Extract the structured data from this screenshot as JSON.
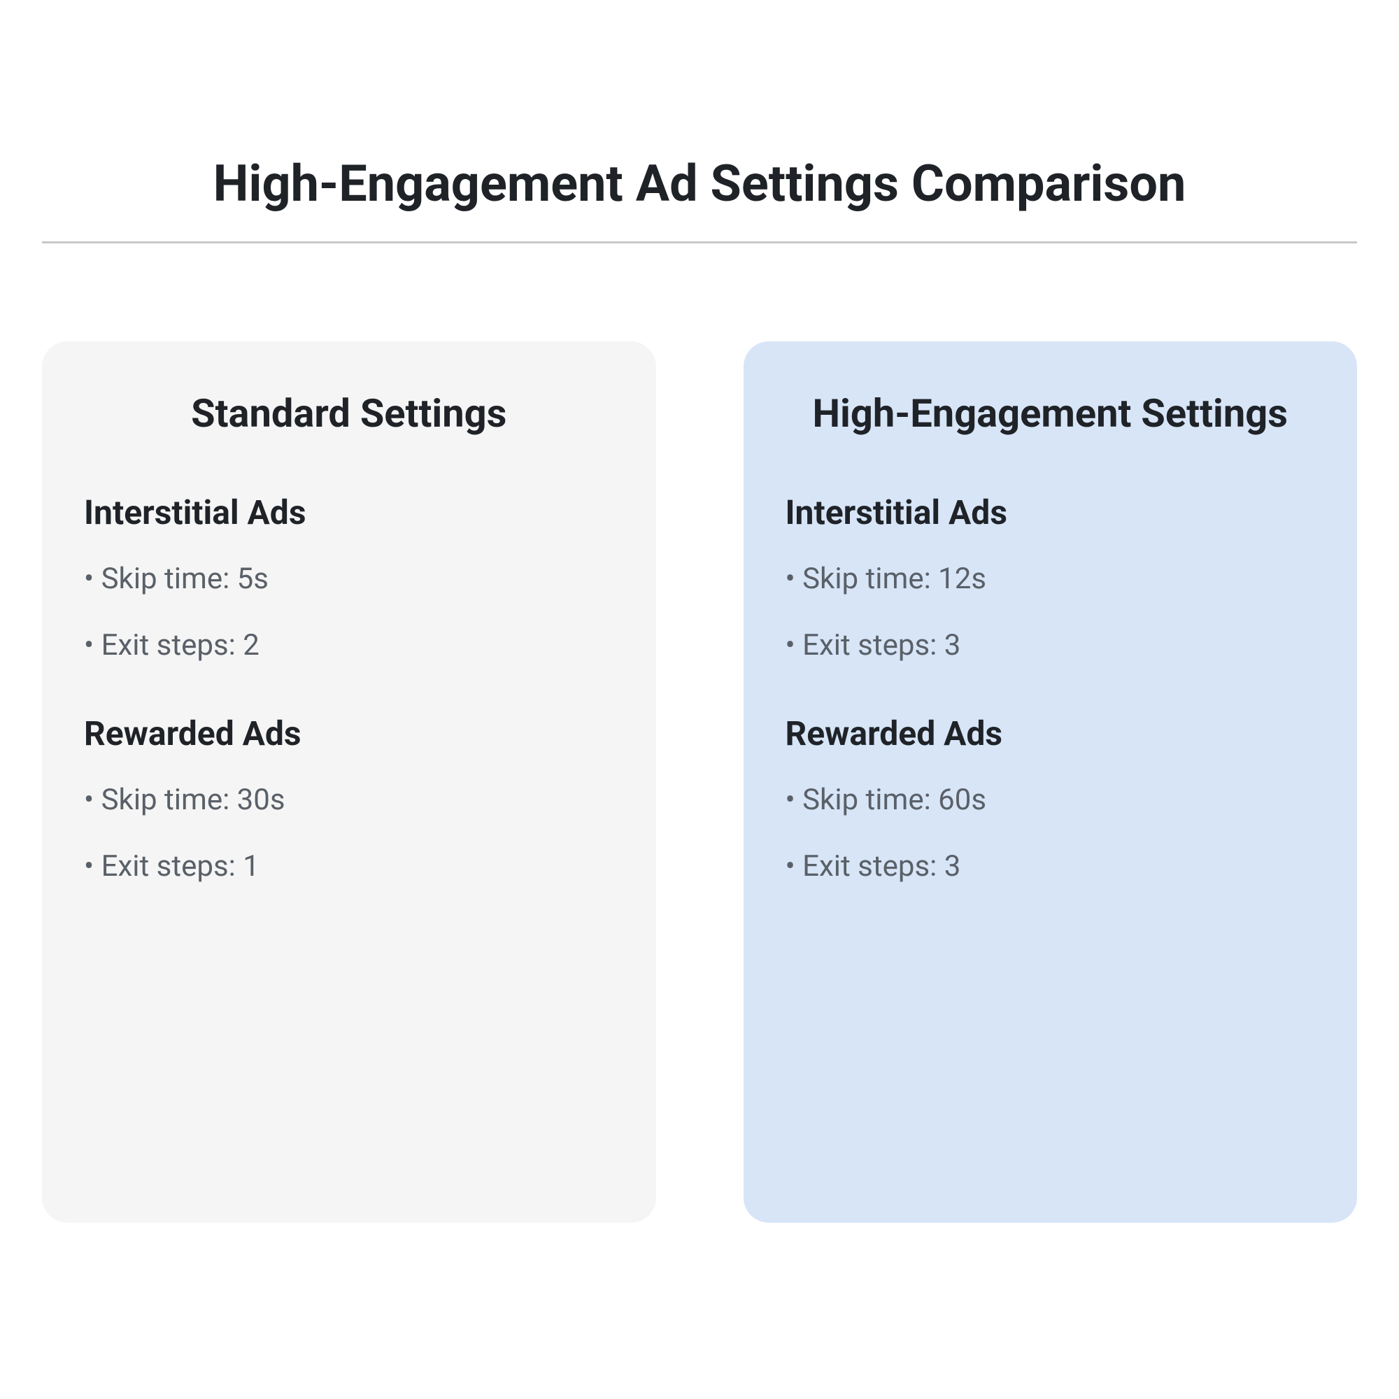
{
  "title": "High-Engagement Ad Settings Comparison",
  "cards": {
    "standard": {
      "title": "Standard Settings",
      "sections": {
        "interstitial": {
          "heading": "Interstitial Ads",
          "skip": "• Skip time: 5s",
          "exit": "• Exit steps: 2"
        },
        "rewarded": {
          "heading": "Rewarded Ads",
          "skip": "• Skip time: 30s",
          "exit": "• Exit steps: 1"
        }
      }
    },
    "high": {
      "title": "High-Engagement Settings",
      "sections": {
        "interstitial": {
          "heading": "Interstitial Ads",
          "skip": "• Skip time: 12s",
          "exit": "• Exit steps: 3"
        },
        "rewarded": {
          "heading": "Rewarded Ads",
          "skip": "• Skip time: 60s",
          "exit": "• Exit steps: 3"
        }
      }
    }
  }
}
